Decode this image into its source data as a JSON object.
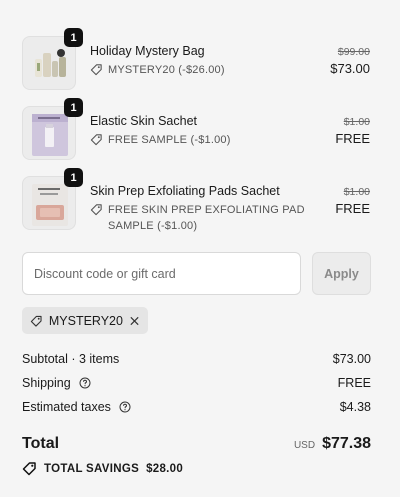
{
  "line_items": [
    {
      "name": "Holiday Mystery Bag",
      "quantity": "1",
      "discount": "MYSTERY20 (-$26.00)",
      "original_price": "$99.00",
      "price": "$73.00"
    },
    {
      "name": "Elastic Skin Sachet",
      "quantity": "1",
      "discount": "FREE SAMPLE (-$1.00)",
      "original_price": "$1.00",
      "price": "FREE"
    },
    {
      "name": "Skin Prep Exfoliating Pads Sachet",
      "quantity": "1",
      "discount_line1": "FREE SKIN PREP EXFOLIATING PAD",
      "discount_line2": "SAMPLE (-$1.00)",
      "original_price": "$1.00",
      "price": "FREE"
    }
  ],
  "discount_form": {
    "placeholder": "Discount code or gift card",
    "apply_label": "Apply"
  },
  "applied_code": "MYSTERY20",
  "summary": {
    "subtotal_label": "Subtotal · 3 items",
    "subtotal_value": "$73.00",
    "shipping_label": "Shipping",
    "shipping_value": "FREE",
    "taxes_label": "Estimated taxes",
    "taxes_value": "$4.38",
    "total_label": "Total",
    "currency": "USD",
    "total_value": "$77.38",
    "savings_label": "TOTAL SAVINGS",
    "savings_value": "$28.00"
  },
  "icons": {
    "tag": "tag-icon",
    "help": "question-circle-icon",
    "remove": "close-icon",
    "savings": "savings-tag-icon"
  }
}
